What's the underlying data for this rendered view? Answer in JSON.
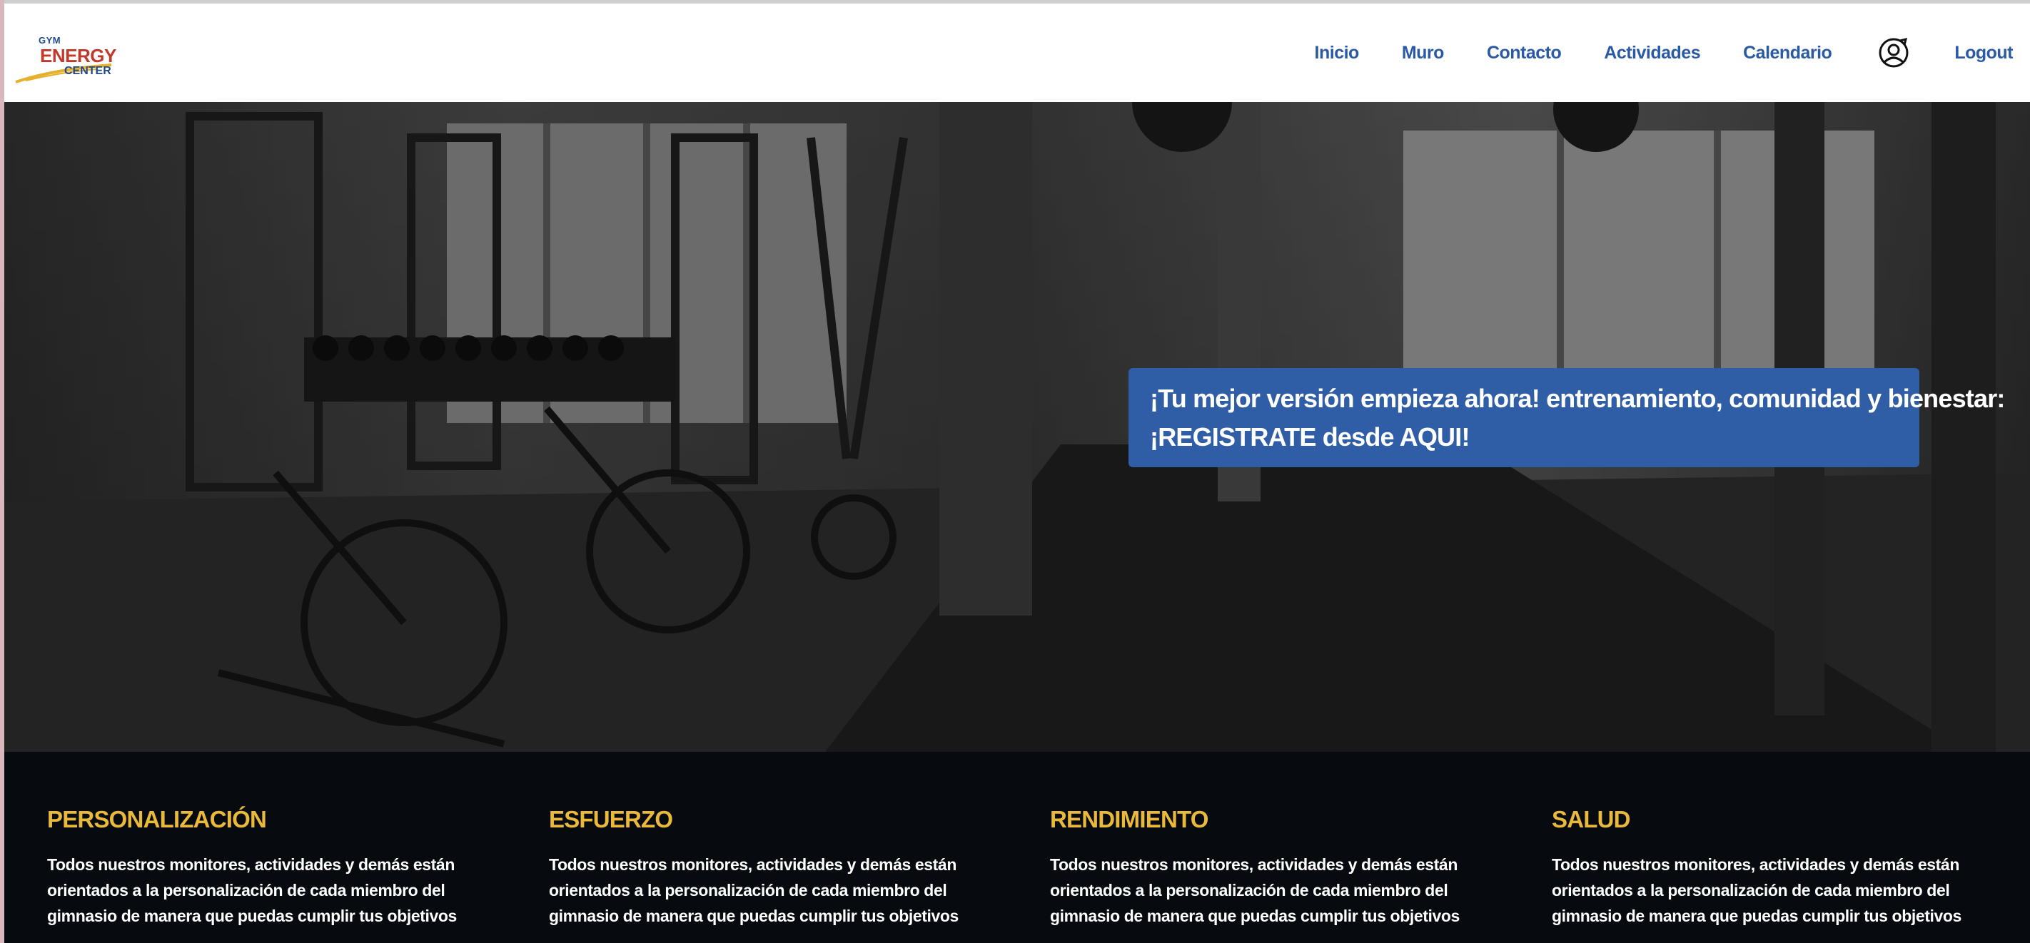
{
  "header": {
    "logo": {
      "gym": "GYM",
      "energy": "ENERGY",
      "center": "CENTER"
    },
    "nav": [
      {
        "label": "Inicio"
      },
      {
        "label": "Muro"
      },
      {
        "label": "Contacto"
      },
      {
        "label": "Actividades"
      },
      {
        "label": "Calendario"
      }
    ],
    "profile_icon": "user-circle-icon",
    "logout_label": "Logout"
  },
  "hero": {
    "cta_line1": "¡Tu mejor versión empieza ahora! entrenamiento, comunidad y bienestar:",
    "cta_line2": "¡REGISTRATE desde AQUI!"
  },
  "features": [
    {
      "title": "PERSONALIZACIÓN",
      "text": "Todos nuestros monitores, actividades y demás están orientados a la personalización de cada miembro del gimnasio de manera que puedas cumplir tus objetivos"
    },
    {
      "title": "ESFUERZO",
      "text": "Todos nuestros monitores, actividades y demás están orientados a la personalización de cada miembro del gimnasio de manera que puedas cumplir tus objetivos"
    },
    {
      "title": "RENDIMIENTO",
      "text": "Todos nuestros monitores, actividades y demás están orientados a la personalización de cada miembro del gimnasio de manera que puedas cumplir tus objetivos"
    },
    {
      "title": "SALUD",
      "text": "Todos nuestros monitores, actividades y demás están orientados a la personalización de cada miembro del gimnasio de manera que puedas cumplir tus objetivos"
    }
  ],
  "colors": {
    "nav": "#2a5aa6",
    "cta_bg": "#2f5ea6",
    "feature_title": "#eab93a",
    "features_bg": "#070b10"
  }
}
